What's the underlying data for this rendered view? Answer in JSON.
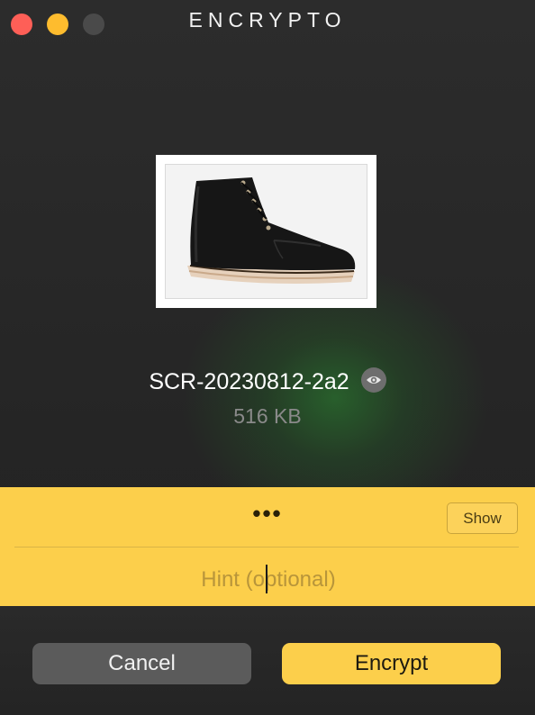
{
  "window": {
    "title": "ENCRYPTO"
  },
  "file": {
    "name": "SCR-20230812-2a2",
    "size": "516 KB",
    "preview_icon": "eye-icon",
    "thumbnail_subject": "black leather lace-up boot"
  },
  "password": {
    "masked_value": "•••",
    "show_label": "Show"
  },
  "hint": {
    "placeholder": "Hint (optional)",
    "value": ""
  },
  "actions": {
    "cancel_label": "Cancel",
    "encrypt_label": "Encrypt"
  },
  "colors": {
    "accent": "#fccf4b",
    "close": "#fe5f57",
    "minimize": "#febc2e",
    "zoom_inactive": "#4a4a4a",
    "cancel_button": "#5b5b5b"
  }
}
